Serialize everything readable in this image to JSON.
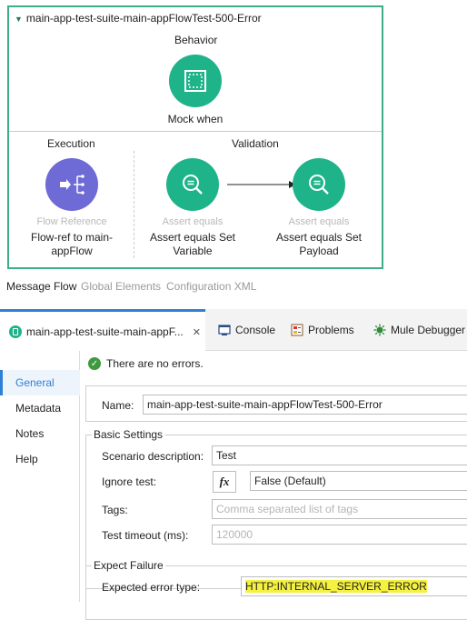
{
  "suite": {
    "title": "main-app-test-suite-main-appFlowTest-500-Error",
    "behavior": {
      "label": "Behavior",
      "component_name": "Mock when"
    },
    "execution": {
      "label": "Execution",
      "component_type": "Flow Reference",
      "component_name_line1": "Flow-ref to main-",
      "component_name_line2": "appFlow"
    },
    "validation": {
      "label": "Validation",
      "items": [
        {
          "type": "Assert equals",
          "name_line1": "Assert equals Set",
          "name_line2": "Variable"
        },
        {
          "type": "Assert equals",
          "name_line1": "Assert equals Set",
          "name_line2": "Payload"
        }
      ]
    },
    "colors": {
      "accent": "#3fae86",
      "component_green": "#1fb38a",
      "component_purple": "#6e6ad6"
    }
  },
  "view_tabs": [
    "Message Flow",
    "Global Elements",
    "Configuration XML"
  ],
  "panel_tabs": {
    "editor": "main-app-test-suite-main-appF...",
    "console": "Console",
    "problems": "Problems",
    "debugger": "Mule Debugger"
  },
  "sidebar": [
    "General",
    "Metadata",
    "Notes",
    "Help"
  ],
  "status": "There are no errors.",
  "form": {
    "name_label": "Name:",
    "name_value": "main-app-test-suite-main-appFlowTest-500-Error",
    "basic_settings": "Basic Settings",
    "scenario_label": "Scenario description:",
    "scenario_value": "Test",
    "ignore_label": "Ignore test:",
    "fx": "fx",
    "ignore_value": "False (Default)",
    "tags_label": "Tags:",
    "tags_placeholder": "Comma separated list of tags",
    "timeout_label": "Test timeout (ms):",
    "timeout_placeholder": "120000",
    "expect_failure": "Expect Failure",
    "error_type_label": "Expected error type:",
    "error_type_value": "HTTP:INTERNAL_SERVER_ERROR"
  }
}
